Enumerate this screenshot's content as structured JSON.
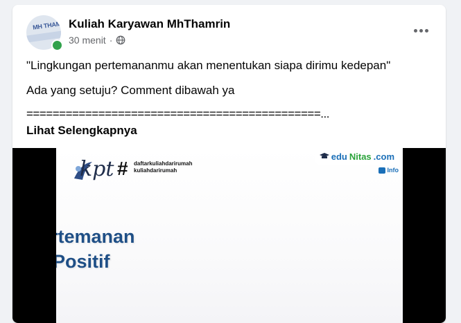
{
  "post": {
    "page_name": "Kuliah Karyawan MhThamrin",
    "time": "30 menit",
    "separator": "·",
    "avatar_text": "MH THAMRIN",
    "text_lines": [
      "\"Lingkungan pertemananmu akan menentukan siapa dirimu kedepan\"",
      "Ada yang setuju? Comment dibawah ya",
      "=============================================..."
    ],
    "see_more": "Lihat Selengkapnya"
  },
  "media": {
    "logo": "kpt",
    "hash": "#",
    "tags": [
      "daftarkuliahdarirumah",
      "kuliahdarirumah"
    ],
    "brand": {
      "prefix": "edu",
      "main": "Nitas",
      "suffix": ".com"
    },
    "info_label": "Info",
    "headline_line1": "rtemanan",
    "headline_line2": "Positif"
  },
  "icons": {
    "globe": "globe-icon",
    "more": "more-options-icon",
    "status": "online-status-icon"
  },
  "colors": {
    "page_bg": "#f0f2f5",
    "text_primary": "#050505",
    "text_secondary": "#65676b",
    "online": "#31a24c",
    "headline": "#1f4f86",
    "brand_blue": "#1a6fb8",
    "brand_green": "#2aa33a"
  }
}
